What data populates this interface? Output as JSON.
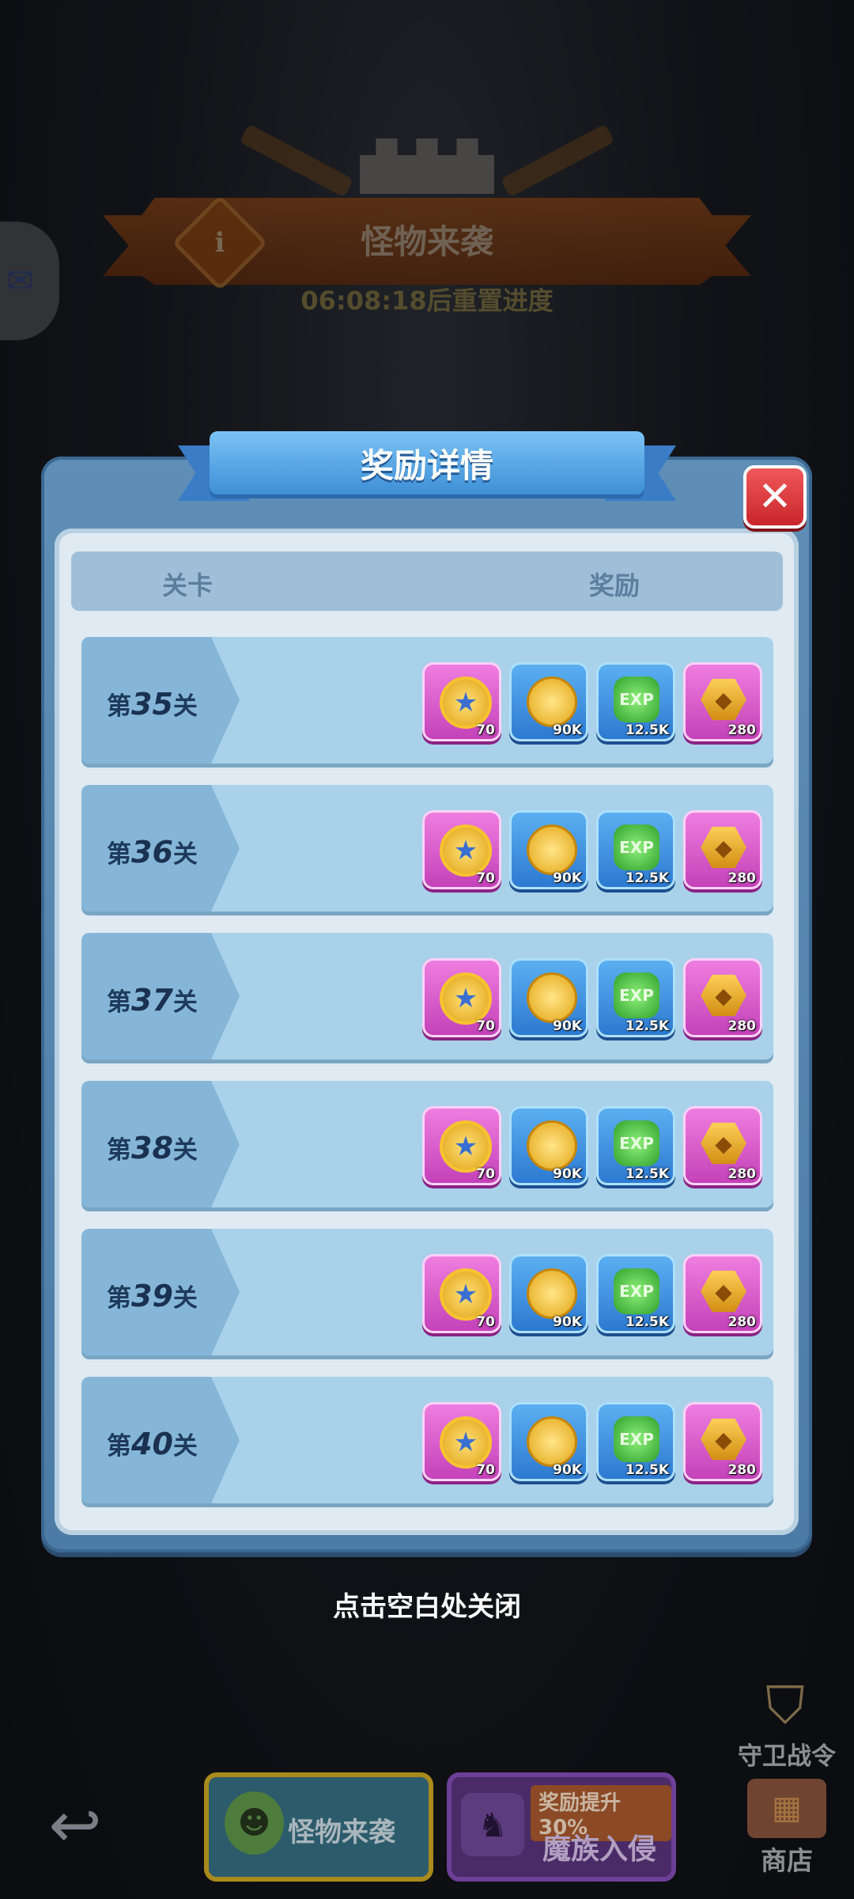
{
  "event": {
    "title": "怪物来袭",
    "reset_timer": "06:08:18后重置进度"
  },
  "modal": {
    "title": "奖励详情",
    "close_glyph": "✕",
    "columns": {
      "level": "关卡",
      "reward": "奖励"
    },
    "rows": [
      {
        "prefix": "第",
        "number": "35",
        "suffix": "关"
      },
      {
        "prefix": "第",
        "number": "36",
        "suffix": "关"
      },
      {
        "prefix": "第",
        "number": "37",
        "suffix": "关"
      },
      {
        "prefix": "第",
        "number": "38",
        "suffix": "关"
      },
      {
        "prefix": "第",
        "number": "39",
        "suffix": "关"
      },
      {
        "prefix": "第",
        "number": "40",
        "suffix": "关"
      }
    ],
    "rewards": [
      {
        "icon": "star-medal-icon",
        "qty": "70",
        "frame": "purple"
      },
      {
        "icon": "gold-coin-icon",
        "qty": "90K",
        "frame": "blue"
      },
      {
        "icon": "exp-gem-icon",
        "qty": "12.5K",
        "frame": "blue",
        "glyph_text": "EXP"
      },
      {
        "icon": "gold-hexagon-token-icon",
        "qty": "280",
        "frame": "purple"
      }
    ],
    "close_hint": "点击空白处关闭"
  },
  "bottom": {
    "tab_monster": "怪物来袭",
    "tab_demon_promo": "奖励提升30%",
    "tab_demon": "魔族入侵",
    "pass_label": "守卫战令",
    "shop_label": "商店"
  },
  "colors": {
    "modal_blue": "#4b7ca6",
    "row_blue": "#a9d1ea",
    "close_red": "#c8262b",
    "reward_purple": "#c240b7",
    "reward_blue": "#2b78d0"
  }
}
